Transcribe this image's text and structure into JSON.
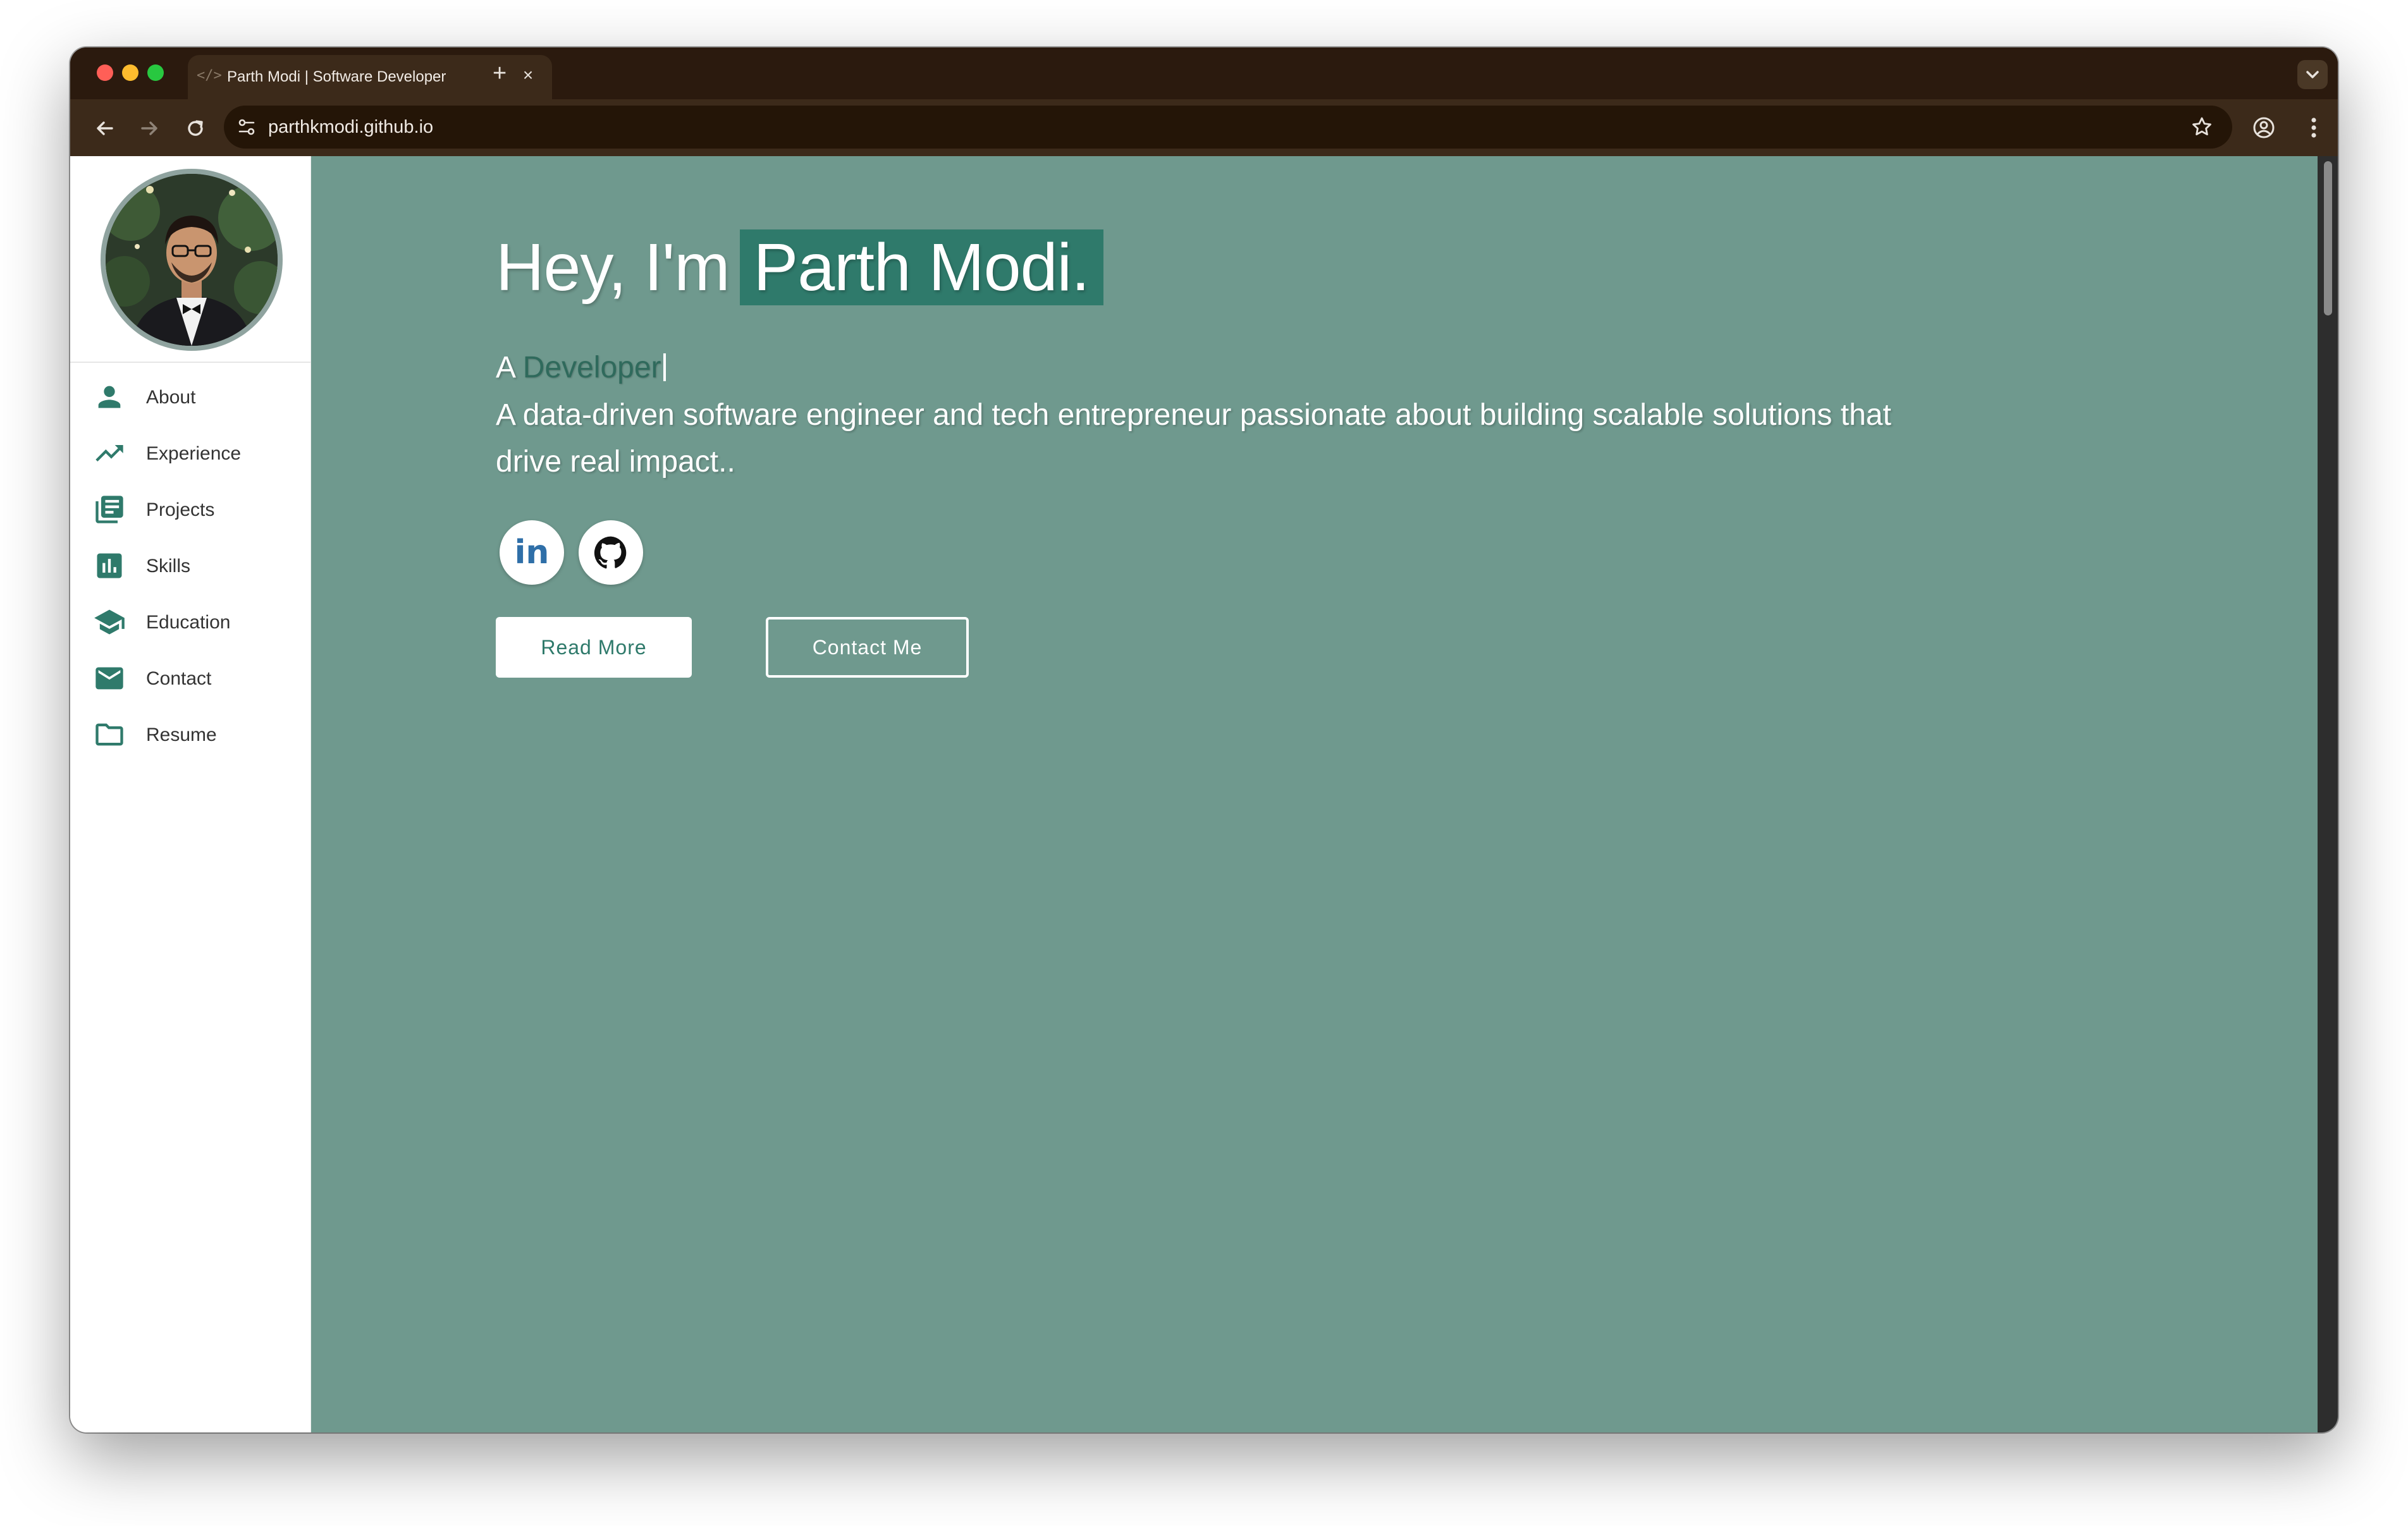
{
  "browser": {
    "tab_title": "Parth Modi | Software Developer",
    "tab_favicon": "</>",
    "tab_close": "×",
    "new_tab": "+",
    "url": "parthkmodi.github.io"
  },
  "sidebar": {
    "avatar_alt": "Profile photo",
    "items": [
      {
        "label": "About",
        "icon": "person-icon"
      },
      {
        "label": "Experience",
        "icon": "trending-up-icon"
      },
      {
        "label": "Projects",
        "icon": "library-books-icon"
      },
      {
        "label": "Skills",
        "icon": "bar-chart-icon"
      },
      {
        "label": "Education",
        "icon": "school-icon"
      },
      {
        "label": "Contact",
        "icon": "mail-icon"
      },
      {
        "label": "Resume",
        "icon": "folder-icon"
      }
    ]
  },
  "hero": {
    "greeting": "Hey, I'm",
    "name": "Parth Modi.",
    "typed_prefix": "A",
    "typed_role": "Developer",
    "description": "A data-driven software engineer and tech entrepreneur passionate about building scalable solutions that drive real impact..",
    "social": [
      {
        "name": "linkedin",
        "icon": "linkedin-icon",
        "text": "in"
      },
      {
        "name": "github",
        "icon": "github-icon"
      }
    ],
    "buttons": {
      "read_more": "Read More",
      "contact_me": "Contact Me"
    }
  },
  "colors": {
    "accent": "#2f7a6b",
    "content_background": "#6f998e",
    "browser_frame": "#2b1a0e"
  }
}
